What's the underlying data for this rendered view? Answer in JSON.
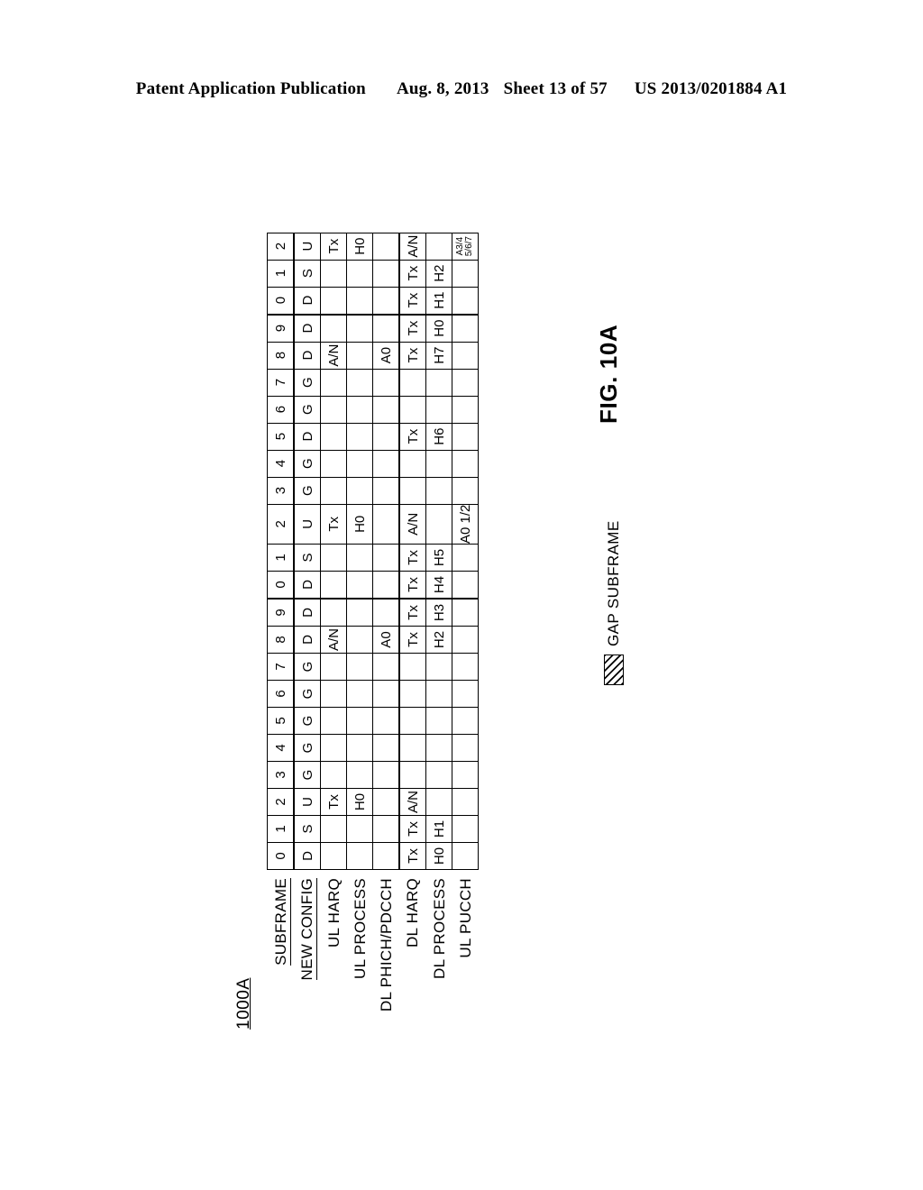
{
  "page_header": {
    "publication": "Patent Application Publication",
    "date": "Aug. 8, 2013",
    "sheet": "Sheet 13 of 57",
    "patent_number": "US 2013/0201884 A1"
  },
  "figure": {
    "reference_numeral": "1000A",
    "caption": "FIG. 10A",
    "legend": {
      "swatch_label": "GAP  SUBFRAME"
    }
  },
  "table": {
    "row_labels": {
      "subframe": "SUBFRAME",
      "new_config": "NEW CONFIG",
      "ul_harq": "UL HARQ",
      "ul_process": "UL  PROCESS",
      "dl_phich_pdcch": "DL  PHICH/PDCCH",
      "dl_harq": "DL HARQ",
      "dl_process": "DL  PROCESS",
      "ul_pucch": "UL  PUCCH"
    },
    "subframe": [
      "0",
      "1",
      "2",
      "3",
      "4",
      "5",
      "6",
      "7",
      "8",
      "9",
      "0",
      "1",
      "2",
      "3",
      "4",
      "5",
      "6",
      "7",
      "8",
      "9",
      "0",
      "1",
      "2"
    ],
    "new_config": [
      "D",
      "S",
      "U",
      "G",
      "G",
      "G",
      "G",
      "G",
      "D",
      "D",
      "D",
      "S",
      "U",
      "G",
      "G",
      "D",
      "G",
      "G",
      "D",
      "D",
      "D",
      "S",
      "U"
    ],
    "new_config_gap": [
      false,
      false,
      false,
      true,
      true,
      true,
      true,
      true,
      false,
      false,
      false,
      false,
      false,
      true,
      true,
      false,
      true,
      true,
      false,
      false,
      false,
      false,
      false
    ],
    "ul_harq": [
      "",
      "",
      "Tx",
      "",
      "",
      "",
      "",
      "",
      "A/N",
      "",
      "",
      "",
      "Tx",
      "",
      "",
      "",
      "",
      "",
      "A/N",
      "",
      "",
      "",
      "Tx"
    ],
    "ul_process": [
      "",
      "",
      "H0",
      "",
      "",
      "",
      "",
      "",
      "",
      "",
      "",
      "",
      "H0",
      "",
      "",
      "",
      "",
      "",
      "",
      "",
      "",
      "",
      "H0"
    ],
    "dl_phich_pdcch": [
      "",
      "",
      "",
      "",
      "",
      "",
      "",
      "",
      "A0",
      "",
      "",
      "",
      "",
      "",
      "",
      "",
      "",
      "",
      "A0",
      "",
      "",
      "",
      ""
    ],
    "dl_harq": [
      "Tx",
      "Tx",
      "A/N",
      "",
      "",
      "",
      "",
      "",
      "Tx",
      "Tx",
      "Tx",
      "Tx",
      "A/N",
      "",
      "",
      "Tx",
      "",
      "",
      "Tx",
      "Tx",
      "Tx",
      "Tx",
      "A/N"
    ],
    "dl_process": [
      "H0",
      "H1",
      "",
      "",
      "",
      "",
      "",
      "",
      "H2",
      "H3",
      "H4",
      "H5",
      "",
      "",
      "",
      "H6",
      "",
      "",
      "H7",
      "H0",
      "H1",
      "H2",
      ""
    ],
    "ul_pucch": [
      "",
      "",
      "",
      "",
      "",
      "",
      "",
      "",
      "",
      "",
      "",
      "",
      "A0 1/2",
      "",
      "",
      "",
      "",
      "",
      "",
      "",
      "",
      "",
      "A3/4 5/6/7"
    ],
    "ul_pucch_small": [
      false,
      false,
      false,
      false,
      false,
      false,
      false,
      false,
      false,
      false,
      false,
      false,
      false,
      false,
      false,
      false,
      false,
      false,
      false,
      false,
      false,
      false,
      true
    ],
    "ul_pucch_line1": "A3/4",
    "ul_pucch_line2": "5/6/7",
    "gap_columns": [
      3,
      4,
      5,
      6,
      7,
      13,
      14,
      16,
      17
    ]
  }
}
